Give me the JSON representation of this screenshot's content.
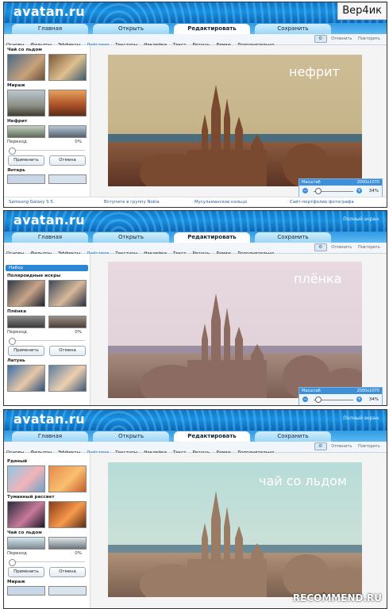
{
  "badge": "Вер4ик",
  "watermark": "RECOMMEND.RU",
  "app": {
    "logo": "avatan.ru",
    "fullscreen": "Полный экран"
  },
  "tabs": [
    "Главная",
    "Открыть",
    "Редактировать",
    "Сохранить"
  ],
  "menu": [
    "Основы",
    "Фильтры",
    "Эффекты",
    "Действия",
    "Текстуры",
    "Наклейки",
    "Текст",
    "Ретушь",
    "Рамки",
    "Дополнительно"
  ],
  "tools": {
    "undo": "Отменить",
    "redo": "Повторить"
  },
  "zoom": {
    "label": "Масштаб",
    "dims": "2000x1070",
    "percent": "34%",
    "minus": "−",
    "plus": "+"
  },
  "panels": [
    {
      "photo_label": "нефрит",
      "top_effect": "Чай со льдом",
      "effect2": "Мираж",
      "active_effect": "Нефрит",
      "option": "Переход",
      "option_value": "0%",
      "apply": "Применить",
      "cancel": "Отмена",
      "next_effect": "Янтарь",
      "footer": [
        "Samsung Galaxy S 5.",
        "Вступите в группу Nokia",
        "Мусульманское кольцо",
        "Сайт-портфолио фотографа"
      ]
    },
    {
      "photo_label": "плёнка",
      "group": "Набор",
      "top_effect": "Поляроидные искры",
      "active_effect": "Плёнка",
      "option": "Переход",
      "option_value": "0%",
      "apply": "Применить",
      "cancel": "Отмена",
      "next_effect": "Латунь"
    },
    {
      "photo_label": "чай со льдом",
      "top_effect": "Рдяный",
      "effect2": "Туманный рассвет",
      "active_effect": "Чай со льдом",
      "option": "Переход",
      "option_value": "0%",
      "apply": "Применить",
      "cancel": "Отмена",
      "next_effect": "Мираж"
    }
  ],
  "colors": {
    "header": "#1a8fe0",
    "accent": "#2c86d6"
  }
}
